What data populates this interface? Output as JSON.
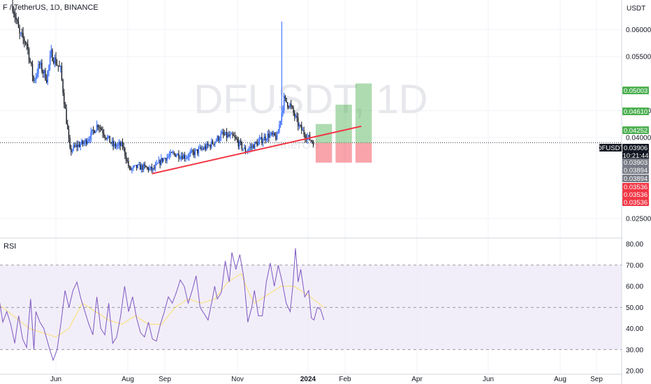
{
  "header": {
    "symbol_line": "F / TetherUS, 1D, BINANCE"
  },
  "watermark": {
    "main": "DFUSDT, 1D",
    "sub": "DF / TetherUS"
  },
  "currency_label": "USDT",
  "rsi_panel": {
    "title": "RSI"
  },
  "colors": {
    "candle": "#2962ff",
    "candle_dark": "#131722",
    "trendline": "#f23645",
    "profit_zone": "#4caf50",
    "loss_zone": "#f23645",
    "rsi_line": "#7e57c2",
    "rsi_ma": "#fdd835",
    "rsi_band": "#ede7f6"
  },
  "price_badges": [
    {
      "label": "0.05003",
      "kind": "target",
      "color": "#4caf50"
    },
    {
      "label": "0.04610",
      "kind": "target",
      "color": "#4caf50"
    },
    {
      "label": "0.04252",
      "kind": "target",
      "color": "#4caf50"
    },
    {
      "label": "DFUSDT",
      "kind": "symbol",
      "color": "#131722"
    },
    {
      "label": "0.03906",
      "kind": "last",
      "color": "#131722"
    },
    {
      "label": "10:21:44",
      "kind": "countdown",
      "color": "#131722"
    },
    {
      "label": "0.03903",
      "kind": "entry",
      "color": "#787b86"
    },
    {
      "label": "0.03894",
      "kind": "entry",
      "color": "#787b86"
    },
    {
      "label": "0.03894",
      "kind": "entry",
      "color": "#787b86"
    },
    {
      "label": "0.03536",
      "kind": "stop",
      "color": "#f23645"
    },
    {
      "label": "0.03536",
      "kind": "stop",
      "color": "#f23645"
    },
    {
      "label": "0.03536",
      "kind": "stop",
      "color": "#f23645"
    }
  ],
  "chart_data": [
    {
      "type": "candlestick",
      "title": "DFUSDT, 1D",
      "y_ticks": [
        "0.06000",
        "0.05500",
        "0.04500",
        "0.04000",
        "0.02500"
      ],
      "ylim": [
        0.0215,
        0.0655
      ],
      "x_ticks": [
        "Jun",
        "Aug",
        "Sep",
        "Nov",
        "2024",
        "Feb",
        "Apr",
        "Jun",
        "Aug",
        "Sep"
      ],
      "last_price": 0.03906,
      "price_path": [
        [
          "2023-05-10",
          0.0645
        ],
        [
          "2023-05-16",
          0.059
        ],
        [
          "2023-05-22",
          0.0575
        ],
        [
          "2023-05-28",
          0.0505
        ],
        [
          "2023-06-02",
          0.0535
        ],
        [
          "2023-06-08",
          0.051
        ],
        [
          "2023-06-12",
          0.0555
        ],
        [
          "2023-06-16",
          0.054
        ],
        [
          "2023-06-20",
          0.0525
        ],
        [
          "2023-06-24",
          0.045
        ],
        [
          "2023-06-28",
          0.0375
        ],
        [
          "2023-07-04",
          0.0385
        ],
        [
          "2023-07-10",
          0.039
        ],
        [
          "2023-07-16",
          0.0405
        ],
        [
          "2023-07-22",
          0.0425
        ],
        [
          "2023-07-28",
          0.0405
        ],
        [
          "2023-08-04",
          0.0385
        ],
        [
          "2023-08-12",
          0.0385
        ],
        [
          "2023-08-18",
          0.034
        ],
        [
          "2023-08-24",
          0.0345
        ],
        [
          "2023-08-30",
          0.0345
        ],
        [
          "2023-09-07",
          0.034
        ],
        [
          "2023-09-15",
          0.036
        ],
        [
          "2023-09-25",
          0.037
        ],
        [
          "2023-10-05",
          0.0365
        ],
        [
          "2023-10-15",
          0.0375
        ],
        [
          "2023-10-25",
          0.0385
        ],
        [
          "2023-11-05",
          0.0405
        ],
        [
          "2023-11-15",
          0.04
        ],
        [
          "2023-11-25",
          0.0375
        ],
        [
          "2023-12-05",
          0.039
        ],
        [
          "2023-12-15",
          0.0405
        ],
        [
          "2023-12-22",
          0.04
        ],
        [
          "2023-12-28",
          0.047
        ],
        [
          "2024-01-02",
          0.046
        ],
        [
          "2024-01-06",
          0.044
        ],
        [
          "2024-01-10",
          0.042
        ],
        [
          "2024-01-15",
          0.0405
        ],
        [
          "2024-01-20",
          0.0395
        ],
        [
          "2024-01-23",
          0.03906
        ]
      ],
      "spike": {
        "date": "2023-12-26",
        "high": 0.0615
      },
      "trendline": [
        [
          "2023-09-06",
          0.0333
        ],
        [
          "2024-03-03",
          0.0421
        ]
      ],
      "targets": [
        {
          "start": "2024-01-24",
          "end": "2024-02-07",
          "entry": 0.039,
          "target": 0.04252,
          "stop": 0.03536
        },
        {
          "start": "2024-02-10",
          "end": "2024-02-24",
          "entry": 0.039,
          "target": 0.0461,
          "stop": 0.03536
        },
        {
          "start": "2024-02-27",
          "end": "2024-03-12",
          "entry": 0.039,
          "target": 0.05003,
          "stop": 0.03536
        }
      ]
    },
    {
      "type": "line",
      "title": "RSI",
      "y_ticks": [
        80,
        70,
        60,
        50,
        40,
        30,
        20
      ],
      "ylim": [
        20,
        81.5
      ],
      "bands": [
        30,
        50,
        70
      ],
      "series": [
        {
          "values": [
            [
              -0.13,
              57
            ],
            [
              -0.06,
              55
            ],
            [
              0,
              43
            ],
            [
              0.06,
              48
            ],
            [
              0.12,
              42
            ],
            [
              0.18,
              33
            ],
            [
              0.24,
              46
            ],
            [
              0.3,
              35
            ],
            [
              0.36,
              31
            ],
            [
              0.42,
              54
            ],
            [
              0.47,
              30
            ],
            [
              0.5,
              48
            ],
            [
              0.56,
              43
            ],
            [
              0.62,
              40
            ],
            [
              0.7,
              31
            ],
            [
              0.76,
              25
            ],
            [
              0.82,
              30
            ],
            [
              0.88,
              43
            ],
            [
              0.94,
              58
            ],
            [
              1.0,
              50
            ],
            [
              1.06,
              58
            ],
            [
              1.12,
              62
            ],
            [
              1.18,
              54
            ],
            [
              1.24,
              48
            ],
            [
              1.3,
              42
            ],
            [
              1.36,
              37
            ],
            [
              1.42,
              55
            ],
            [
              1.48,
              40
            ],
            [
              1.54,
              37
            ],
            [
              1.6,
              52
            ],
            [
              1.66,
              33
            ],
            [
              1.72,
              36
            ],
            [
              1.78,
              46
            ],
            [
              1.84,
              60
            ],
            [
              1.9,
              48
            ],
            [
              1.96,
              55
            ],
            [
              2.02,
              45
            ],
            [
              2.08,
              38
            ],
            [
              2.14,
              36
            ],
            [
              2.2,
              43
            ],
            [
              2.26,
              35
            ],
            [
              2.32,
              34
            ],
            [
              2.38,
              42
            ],
            [
              2.44,
              48
            ],
            [
              2.5,
              55
            ],
            [
              2.56,
              52
            ],
            [
              2.62,
              57
            ],
            [
              2.68,
              63
            ],
            [
              2.74,
              60
            ],
            [
              2.8,
              52
            ],
            [
              2.86,
              58
            ],
            [
              2.92,
              65
            ],
            [
              2.98,
              50
            ],
            [
              3.04,
              47
            ],
            [
              3.1,
              44
            ],
            [
              3.16,
              53
            ],
            [
              3.2,
              60
            ],
            [
              3.24,
              54
            ],
            [
              3.3,
              57
            ],
            [
              3.36,
              72
            ],
            [
              3.42,
              62
            ],
            [
              3.46,
              76
            ],
            [
              3.52,
              68
            ],
            [
              3.58,
              75
            ],
            [
              3.64,
              64
            ],
            [
              3.7,
              43
            ],
            [
              3.76,
              50
            ],
            [
              3.8,
              58
            ],
            [
              3.86,
              46
            ],
            [
              3.92,
              46
            ],
            [
              3.98,
              62
            ],
            [
              4.04,
              71
            ],
            [
              4.1,
              60
            ],
            [
              4.16,
              70
            ],
            [
              4.22,
              62
            ],
            [
              4.28,
              52
            ],
            [
              4.34,
              48
            ],
            [
              4.38,
              60
            ],
            [
              4.42,
              78
            ],
            [
              4.46,
              62
            ],
            [
              4.5,
              68
            ],
            [
              4.56,
              55
            ],
            [
              4.62,
              58
            ],
            [
              4.66,
              45
            ],
            [
              4.7,
              44
            ],
            [
              4.75,
              50
            ],
            [
              4.8,
              49
            ],
            [
              4.85,
              44
            ]
          ]
        },
        {
          "values": [
            [
              -0.13,
              52
            ],
            [
              0,
              50
            ],
            [
              0.2,
              45
            ],
            [
              0.4,
              40
            ],
            [
              0.6,
              38
            ],
            [
              0.8,
              36
            ],
            [
              1.0,
              40
            ],
            [
              1.2,
              52
            ],
            [
              1.4,
              48
            ],
            [
              1.6,
              44
            ],
            [
              1.8,
              42
            ],
            [
              2.0,
              46
            ],
            [
              2.2,
              42
            ],
            [
              2.4,
              42
            ],
            [
              2.6,
              50
            ],
            [
              2.8,
              54
            ],
            [
              3.0,
              52
            ],
            [
              3.2,
              54
            ],
            [
              3.4,
              62
            ],
            [
              3.6,
              66
            ],
            [
              3.7,
              58
            ],
            [
              3.8,
              52
            ],
            [
              4.0,
              56
            ],
            [
              4.2,
              60
            ],
            [
              4.4,
              60
            ],
            [
              4.6,
              56
            ],
            [
              4.85,
              50
            ]
          ]
        }
      ]
    }
  ]
}
